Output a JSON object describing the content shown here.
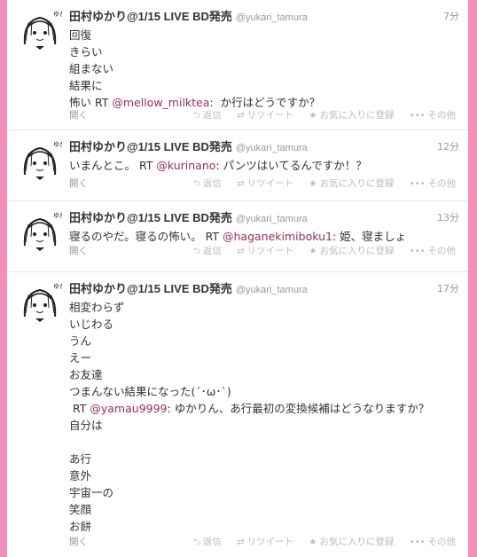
{
  "tweets": [
    {
      "name": "田村ゆかり@1/15 LIVE BD発売",
      "handle": "@yukari_tamura",
      "time": "7分",
      "lines": [
        "回復",
        "きらい",
        "組まない",
        "結果に"
      ],
      "rt_prefix": "怖い RT ",
      "rt_mention": "@mellow_milktea",
      "rt_text": ":  か行はどうですか？"
    },
    {
      "name": "田村ゆかり@1/15 LIVE BD発売",
      "handle": "@yukari_tamura",
      "time": "12分",
      "prefix": "いまんとこ。 RT ",
      "mention": "@kurinano",
      "suffix": ": パンツはいてるんですか！？"
    },
    {
      "name": "田村ゆかり@1/15 LIVE BD発売",
      "handle": "@yukari_tamura",
      "time": "13分",
      "prefix": "寝るのやだ。寝るの怖い。 RT ",
      "mention": "@haganekimiboku1",
      "suffix": ": 姫、寝ましょ"
    },
    {
      "name": "田村ゆかり@1/15 LIVE BD発売",
      "handle": "@yukari_tamura",
      "time": "17分",
      "lines_top": "相変わらず\nいじわる\nうん\nえー\nお友達\nつまんない結果になった(´･ω･`)\n RT ",
      "mention": "@yamau9999",
      "mid": ": ゆかりん、あ行最初の変換候補はどうなりますか？\n自分は\n\nあ行\n意外\n宇宙一の\n笑顔\nお餅"
    }
  ],
  "actions": {
    "expand": "開く",
    "reply": "返信",
    "retweet": "リツイート",
    "favorite": "お気に入りに登録",
    "more": "その他"
  },
  "icons": {
    "reply": "reply-arrow-icon",
    "retweet": "retweet-icon",
    "favorite": "star-icon",
    "more": "more-dots-icon"
  },
  "colors": {
    "background": "#f48fb8",
    "mention": "#9c2b5e",
    "name": "#333333",
    "meta": "#999999"
  }
}
